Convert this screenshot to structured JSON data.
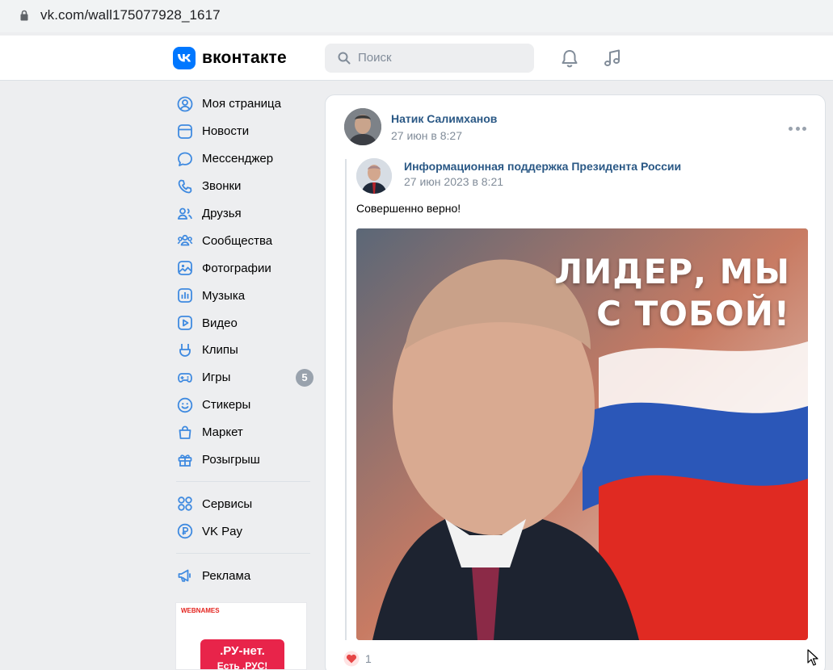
{
  "browser": {
    "url": "vk.com/wall175077928_1617"
  },
  "header": {
    "logo_text": "вконтакте",
    "search_placeholder": "Поиск"
  },
  "sidebar": {
    "items": [
      {
        "label": "Моя страница",
        "icon": "user-circle-icon"
      },
      {
        "label": "Новости",
        "icon": "news-icon"
      },
      {
        "label": "Мессенджер",
        "icon": "message-icon"
      },
      {
        "label": "Звонки",
        "icon": "phone-icon"
      },
      {
        "label": "Друзья",
        "icon": "friends-icon"
      },
      {
        "label": "Сообщества",
        "icon": "communities-icon"
      },
      {
        "label": "Фотографии",
        "icon": "photos-icon"
      },
      {
        "label": "Музыка",
        "icon": "music-icon"
      },
      {
        "label": "Видео",
        "icon": "video-icon"
      },
      {
        "label": "Клипы",
        "icon": "clips-icon"
      },
      {
        "label": "Игры",
        "icon": "games-icon",
        "badge": "5"
      },
      {
        "label": "Стикеры",
        "icon": "stickers-icon"
      },
      {
        "label": "Маркет",
        "icon": "market-icon"
      },
      {
        "label": "Розыгрыш",
        "icon": "gift-icon"
      }
    ],
    "services": [
      {
        "label": "Сервисы",
        "icon": "services-icon"
      },
      {
        "label": "VK Pay",
        "icon": "vkpay-icon"
      }
    ],
    "ads": [
      {
        "label": "Реклама",
        "icon": "megaphone-icon"
      }
    ],
    "ad_banner": {
      "brand": "WEBNAMES",
      "line1": ".РУ-нет.",
      "line2": "Есть .РУС!"
    }
  },
  "post": {
    "author": "Натик Салимханов",
    "date": "27 июн в 8:27",
    "repost": {
      "author": "Информационная поддержка Президента России",
      "date": "27 июн 2023 в 8:21",
      "text": "Совершенно верно!",
      "image_headline_1": "ЛИДЕР, МЫ",
      "image_headline_2": "С ТОБОЙ!"
    },
    "likes": "1"
  },
  "colors": {
    "accent": "#0077ff",
    "link": "#2a5885",
    "like": "#e64646"
  }
}
